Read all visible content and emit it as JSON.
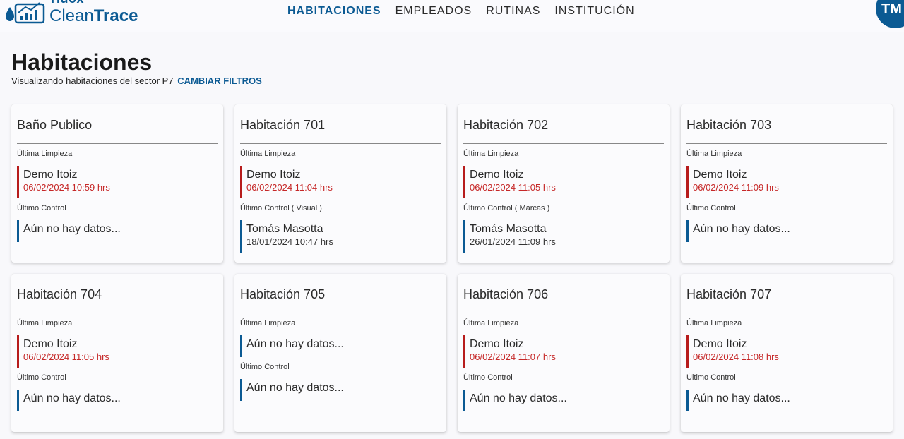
{
  "brand": {
    "top": "Hdox",
    "name_light": "Clean",
    "name_bold": "Trace"
  },
  "nav": [
    {
      "label": "HABITACIONES",
      "active": true
    },
    {
      "label": "EMPLEADOS",
      "active": false
    },
    {
      "label": "RUTINAS",
      "active": false
    },
    {
      "label": "INSTITUCIÓN",
      "active": false
    }
  ],
  "user": {
    "initials": "TM"
  },
  "page": {
    "title": "Habitaciones",
    "subtitle": "Visualizando habitaciones del sector P7",
    "change_filters": "CAMBIAR FILTROS"
  },
  "colors": {
    "primary": "#0b5a93",
    "alert": "#c62828"
  },
  "cards": [
    {
      "title": "Baño Publico",
      "cleaning_label": "Última Limpieza",
      "cleaning_name": "Demo Itoiz",
      "cleaning_date": "06/02/2024 10:59 hrs",
      "control_label": "Último Control",
      "control_name": "Aún no hay datos...",
      "control_date": ""
    },
    {
      "title": "Habitación 701",
      "cleaning_label": "Última Limpieza",
      "cleaning_name": "Demo Itoiz",
      "cleaning_date": "06/02/2024 11:04 hrs",
      "control_label": "Último Control ( Visual )",
      "control_name": "Tomás Masotta",
      "control_date": "18/01/2024 10:47 hrs"
    },
    {
      "title": "Habitación 702",
      "cleaning_label": "Última Limpieza",
      "cleaning_name": "Demo Itoiz",
      "cleaning_date": "06/02/2024 11:05 hrs",
      "control_label": "Último Control ( Marcas )",
      "control_name": "Tomás Masotta",
      "control_date": "26/01/2024 11:09 hrs"
    },
    {
      "title": "Habitación 703",
      "cleaning_label": "Última Limpieza",
      "cleaning_name": "Demo Itoiz",
      "cleaning_date": "06/02/2024 11:09 hrs",
      "control_label": "Último Control",
      "control_name": "Aún no hay datos...",
      "control_date": ""
    },
    {
      "title": "Habitación 704",
      "cleaning_label": "Última Limpieza",
      "cleaning_name": "Demo Itoiz",
      "cleaning_date": "06/02/2024 11:05 hrs",
      "control_label": "Último Control",
      "control_name": "Aún no hay datos...",
      "control_date": ""
    },
    {
      "title": "Habitación 705",
      "cleaning_label": "Última Limpieza",
      "cleaning_name": "Aún no hay datos...",
      "cleaning_date": "",
      "control_label": "Último Control",
      "control_name": "Aún no hay datos...",
      "control_date": ""
    },
    {
      "title": "Habitación 706",
      "cleaning_label": "Última Limpieza",
      "cleaning_name": "Demo Itoiz",
      "cleaning_date": "06/02/2024 11:07 hrs",
      "control_label": "Último Control",
      "control_name": "Aún no hay datos...",
      "control_date": ""
    },
    {
      "title": "Habitación 707",
      "cleaning_label": "Última Limpieza",
      "cleaning_name": "Demo Itoiz",
      "cleaning_date": "06/02/2024 11:08 hrs",
      "control_label": "Último Control",
      "control_name": "Aún no hay datos...",
      "control_date": ""
    }
  ]
}
